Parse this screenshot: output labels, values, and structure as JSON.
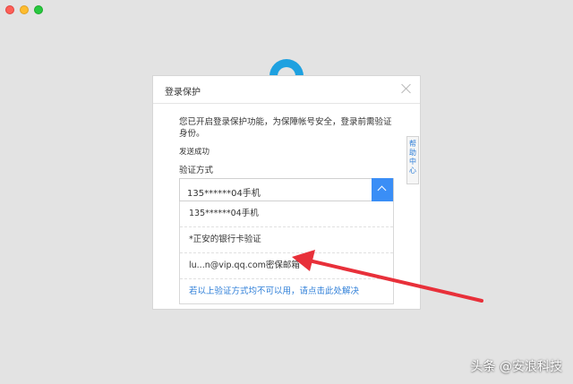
{
  "window": {
    "controls": [
      "close",
      "minimize",
      "zoom"
    ]
  },
  "dialog": {
    "title": "登录保护",
    "description": "您已开启登录保护功能，为保障帐号安全，登录前需验证身份。",
    "sent_status": "发送成功",
    "verify_label": "验证方式",
    "selected_method": "135******04手机",
    "options": [
      "135******04手机",
      "*正安的银行卡验证",
      "lu...n@vip.qq.com密保邮箱"
    ],
    "help_option": "若以上验证方式均不可以用，请点击此处解决"
  },
  "help_tab": {
    "label": "帮助中心"
  },
  "watermark": "头条 @安浪科技",
  "colors": {
    "accent": "#3a8ef6",
    "link": "#2f7fd8",
    "annotation_arrow": "#e8303a"
  }
}
